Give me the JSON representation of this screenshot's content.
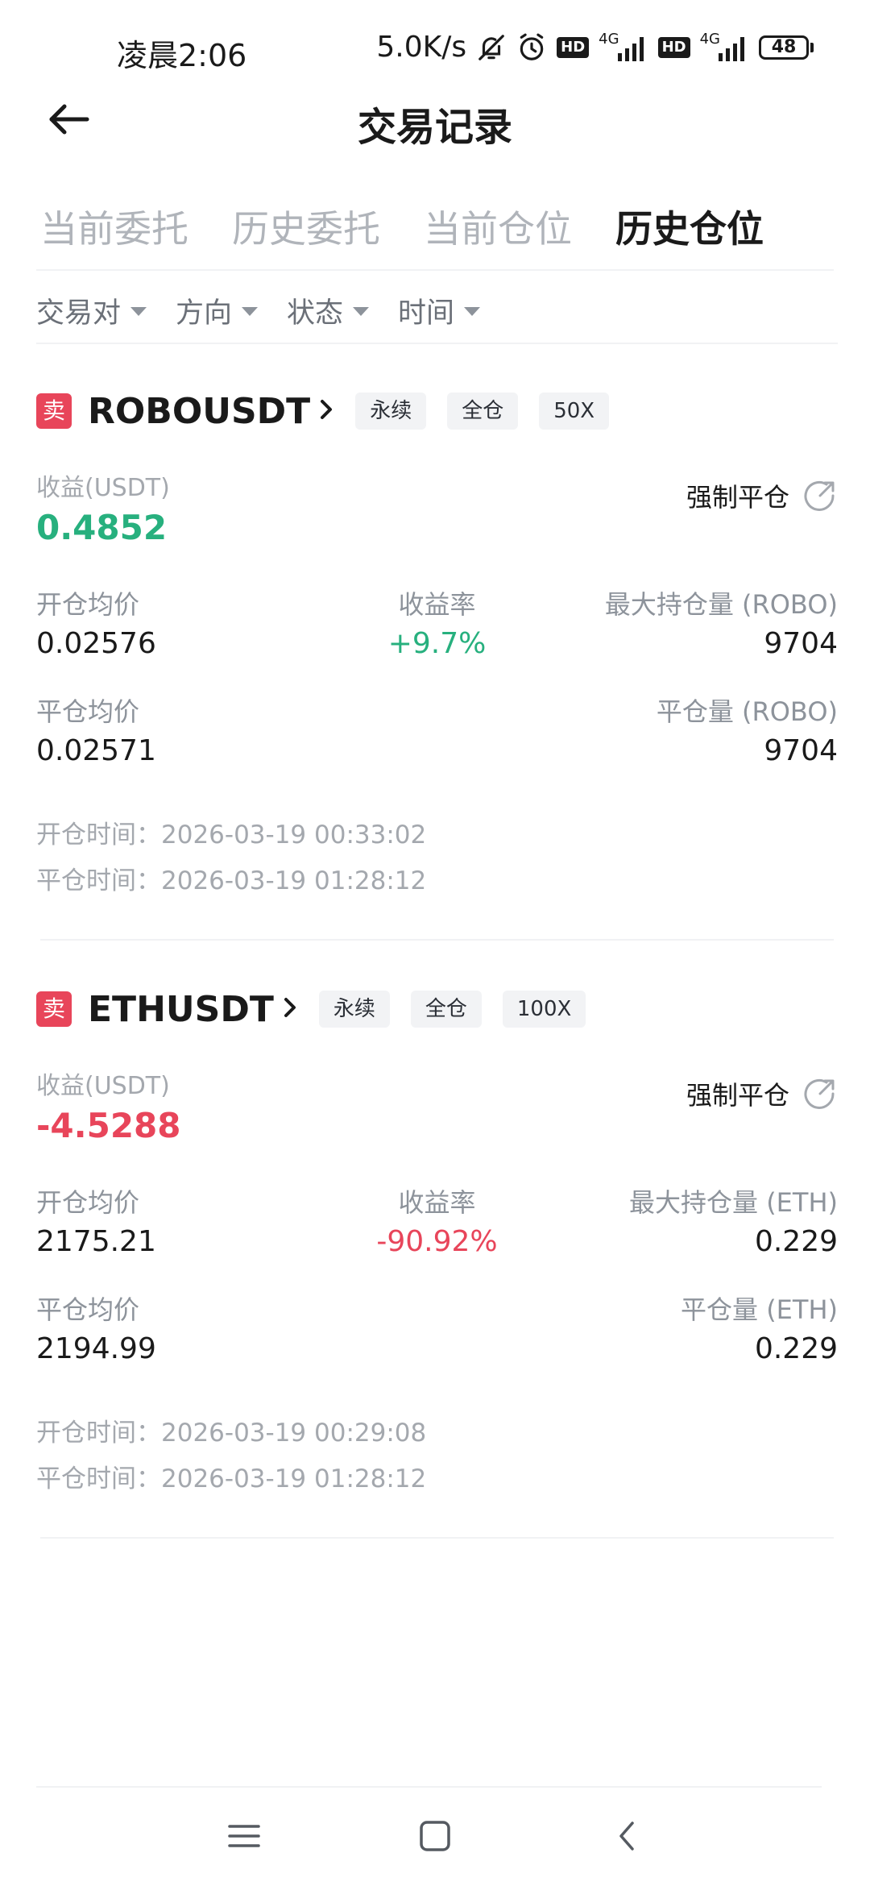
{
  "status_bar": {
    "time": "凌晨2:06",
    "net_speed": "5.0K/s",
    "network_type": "4G",
    "hd_label": "HD",
    "battery": "48",
    "icons": [
      "bell-off-icon",
      "alarm-icon",
      "hd-icon",
      "signal-icon",
      "battery-icon"
    ]
  },
  "header": {
    "title": "交易记录",
    "back_icon": "arrow-left-icon"
  },
  "tabs": [
    {
      "label": "当前委托",
      "active": false
    },
    {
      "label": "历史委托",
      "active": false
    },
    {
      "label": "当前仓位",
      "active": false
    },
    {
      "label": "历史仓位",
      "active": true
    }
  ],
  "filters": [
    {
      "label": "交易对"
    },
    {
      "label": "方向"
    },
    {
      "label": "状态"
    },
    {
      "label": "时间"
    }
  ],
  "positions": [
    {
      "side": "卖",
      "symbol": "ROBOUSDT",
      "tags": [
        "永续",
        "全仓",
        "50X"
      ],
      "pnl_label": "收益(USDT)",
      "pnl_value": "0.4852",
      "force_close_label": "强制平仓",
      "open_avg_label": "开仓均价",
      "open_avg_value": "0.02576",
      "return_rate_label": "收益率",
      "return_rate_value": "+9.7%",
      "max_hold_label": "最大持仓量 (ROBO)",
      "max_hold_value": "9704",
      "close_avg_label": "平仓均价",
      "close_avg_value": "0.02571",
      "close_qty_label": "平仓量 (ROBO)",
      "close_qty_value": "9704",
      "open_time_label": "开仓时间：",
      "open_time_value": "2026-03-19 00:33:02",
      "close_time_label": "平仓时间：",
      "close_time_value": "2026-03-19 01:28:12"
    },
    {
      "side": "卖",
      "symbol": "ETHUSDT",
      "tags": [
        "永续",
        "全仓",
        "100X"
      ],
      "pnl_label": "收益(USDT)",
      "pnl_value": "-4.5288",
      "force_close_label": "强制平仓",
      "open_avg_label": "开仓均价",
      "open_avg_value": "2175.21",
      "return_rate_label": "收益率",
      "return_rate_value": "-90.92%",
      "max_hold_label": "最大持仓量 (ETH)",
      "max_hold_value": "0.229",
      "close_avg_label": "平仓均价",
      "close_avg_value": "2194.99",
      "close_qty_label": "平仓量 (ETH)",
      "close_qty_value": "0.229",
      "open_time_label": "开仓时间：",
      "open_time_value": "2026-03-19 00:29:08",
      "close_time_label": "平仓时间：",
      "close_time_value": "2026-03-19 01:28:12"
    }
  ],
  "colors": {
    "profit": "#27b07e",
    "loss": "#e8455a",
    "sell_badge": "#e8455a",
    "tab_inactive": "#b0b4ba"
  },
  "bottom_nav": [
    "menu-icon",
    "home-icon",
    "back-icon"
  ]
}
